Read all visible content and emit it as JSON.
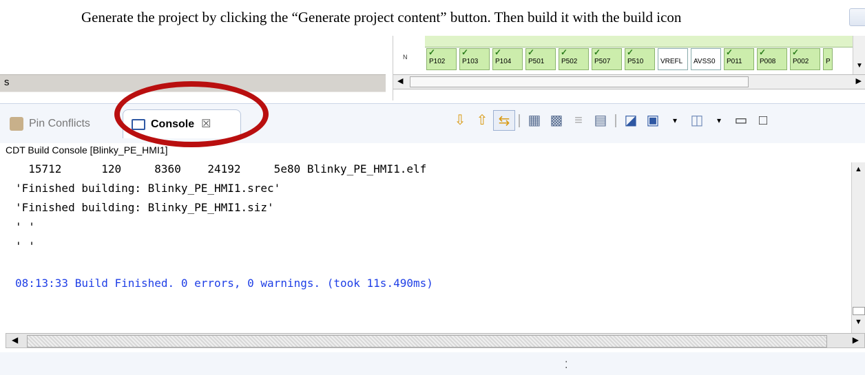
{
  "instruction": {
    "text": "Generate the project by clicking the “Generate project content” button. Then build it with the build icon"
  },
  "left_panel": {
    "label": "s"
  },
  "pin_view": {
    "row_label": "N",
    "pins": [
      "P102",
      "P103",
      "P104",
      "P501",
      "P502",
      "P507",
      "P510",
      "VREFL",
      "AVSS0",
      "P011",
      "P008",
      "P002",
      "P"
    ]
  },
  "console_view": {
    "tabs": [
      {
        "label": "Pin Conflicts",
        "icon": "pin-conflicts-icon"
      },
      {
        "label": "Console",
        "icon": "console-icon",
        "close": "☒"
      }
    ],
    "toolbar_icons": [
      "scroll-down-icon",
      "scroll-up-icon",
      "pin-console-icon",
      "clear-console-icon",
      "lock-icon",
      "word-wrap-icon",
      "remove-console-icon",
      "new-pin-icon",
      "display-console-icon",
      "open-console-icon",
      "minimize-icon",
      "maximize-icon"
    ],
    "title": "CDT Build Console [Blinky_PE_HMI1]",
    "lines": [
      "  15712      120     8360    24192     5e80 Blinky_PE_HMI1.elf",
      "'Finished building: Blinky_PE_HMI1.srec'",
      "'Finished building: Blinky_PE_HMI1.siz'",
      "' '",
      "' '",
      "",
      "",
      "08:13:33 Build Finished. 0 errors, 0 warnings. (took 11s.490ms)"
    ]
  },
  "colors": {
    "annotation": "#b90f0f",
    "build_finished": "#1f3fe6"
  }
}
